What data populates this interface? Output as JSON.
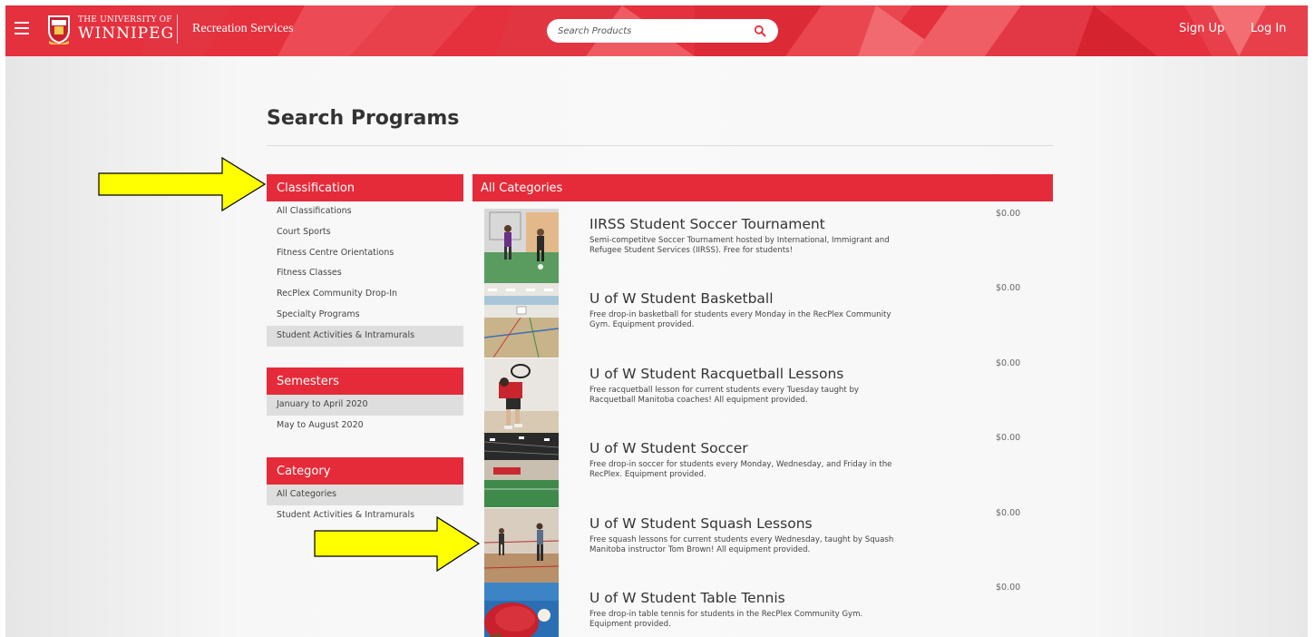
{
  "header": {
    "university_line1": "THE UNIVERSITY OF",
    "university_line2": "WINNIPEG",
    "site_name": "Recreation Services",
    "search_placeholder": "Search Products",
    "sign_up": "Sign Up",
    "log_in": "Log In",
    "accent_color": "#e5303d"
  },
  "page": {
    "title": "Search Programs"
  },
  "classification": {
    "heading": "Classification",
    "items": [
      "All Classifications",
      "Court Sports",
      "Fitness Centre Orientations",
      "Fitness Classes",
      "RecPlex Community Drop-In",
      "Specialty Programs",
      "Student Activities & Intramurals"
    ],
    "selected": "Student Activities & Intramurals"
  },
  "semesters": {
    "heading": "Semesters",
    "items": [
      "January to April 2020",
      "May to August 2020"
    ],
    "selected": "January to April 2020"
  },
  "category": {
    "heading": "Category",
    "items": [
      "All Categories",
      "Student Activities & Intramurals"
    ],
    "selected": "All Categories"
  },
  "results": {
    "heading": "All Categories",
    "products": [
      {
        "title": "IIRSS Student Soccer Tournament",
        "description": "Semi-competitve Soccer Tournament hosted by International, Immigrant and Refugee Student Services (IIRSS). Free for students!",
        "price": "$0.00",
        "image": "soccer-tournament-photo"
      },
      {
        "title": "U of W Student Basketball",
        "description": "Free drop-in basketball for students every Monday in the RecPlex Community Gym. Equipment provided.",
        "price": "$0.00",
        "image": "basketball-gym-photo"
      },
      {
        "title": "U of W Student Racquetball Lessons",
        "description": "Free racquetball lesson for current students every Tuesday taught by Racquetball Manitoba coaches! All equipment provided.",
        "price": "$0.00",
        "image": "racquetball-photo"
      },
      {
        "title": "U of W Student Soccer",
        "description": "Free drop-in soccer for students every Monday, Wednesday, and Friday in the RecPlex. Equipment provided.",
        "price": "$0.00",
        "image": "indoor-soccer-field-photo"
      },
      {
        "title": "U of W Student Squash Lessons",
        "description": "Free squash lessons for current students every Wednesday, taught by Squash Manitoba instructor Tom Brown! All equipment provided.",
        "price": "$0.00",
        "image": "squash-court-photo"
      },
      {
        "title": "U of W Student Table Tennis",
        "description": "Free drop-in table tennis for students in the RecPlex Community Gym. Equipment provided.",
        "price": "$0.00",
        "image": "table-tennis-photo"
      }
    ]
  },
  "annotations": {
    "arrow_color": "#ffff00",
    "arrows": [
      "arrow-pointing-classification",
      "arrow-pointing-squash-lessons"
    ]
  }
}
